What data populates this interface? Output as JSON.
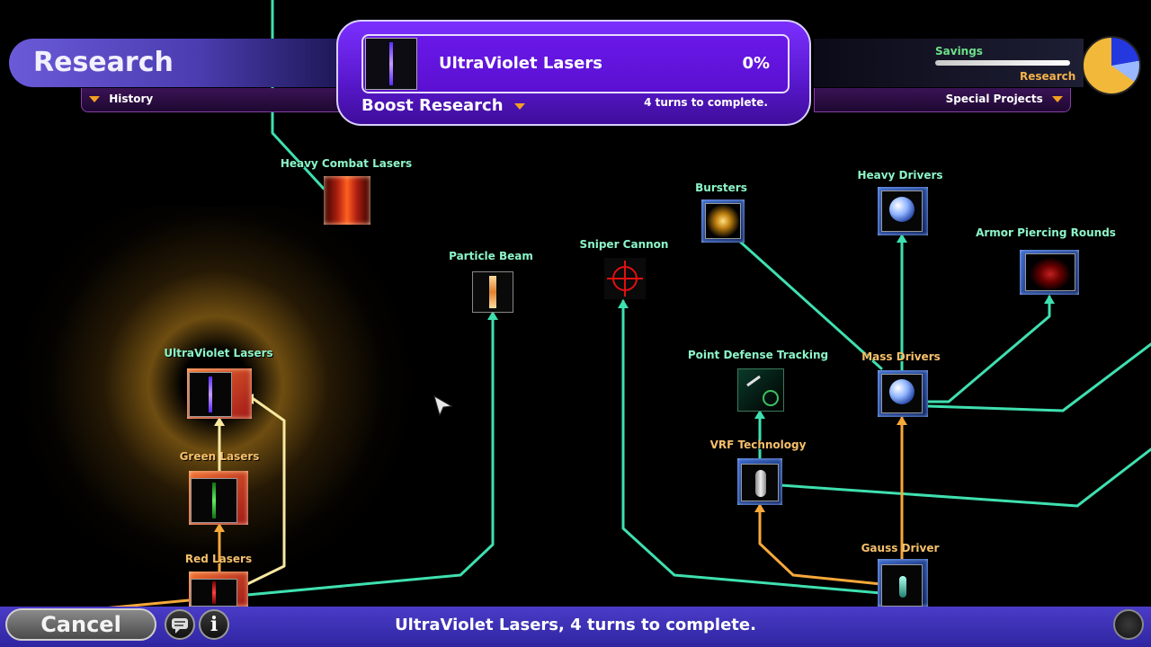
{
  "header": {
    "title": "Research",
    "history_label": "History",
    "special_projects_label": "Special Projects",
    "savings_label": "Savings",
    "research_label": "Research"
  },
  "current_research": {
    "name": "UltraViolet Lasers",
    "percent": "0%",
    "boost_label": "Boost Research",
    "turns_text": "4 turns to complete."
  },
  "techs": {
    "heavy_combat_lasers": "Heavy Combat Lasers",
    "particle_beam": "Particle Beam",
    "sniper_cannon": "Sniper Cannon",
    "bursters": "Bursters",
    "heavy_drivers": "Heavy Drivers",
    "armor_piercing_rounds": "Armor Piercing Rounds",
    "ultraviolet_lasers": "UltraViolet Lasers",
    "point_defense_tracking": "Point Defense Tracking",
    "mass_drivers": "Mass Drivers",
    "vrf_technology": "VRF Technology",
    "green_lasers": "Green Lasers",
    "gauss_driver": "Gauss Driver",
    "red_lasers": "Red Lasers"
  },
  "bottom": {
    "cancel_label": "Cancel",
    "info_icon": "i",
    "status": "UltraViolet Lasers, 4 turns to complete."
  },
  "colors": {
    "link_teal": "#3fe0b0",
    "link_orange": "#f6a83a",
    "link_cream": "#f8e8a0",
    "panel_purple": "#6a1ee8",
    "bar_blue": "#3a30b8"
  },
  "icons": [
    "history-dropdown-icon",
    "special-projects-dropdown-icon",
    "boost-dropdown-icon",
    "chat-icon",
    "info-icon",
    "end-turn-icon",
    "mouse-cursor-icon",
    "budget-pie-icon"
  ]
}
